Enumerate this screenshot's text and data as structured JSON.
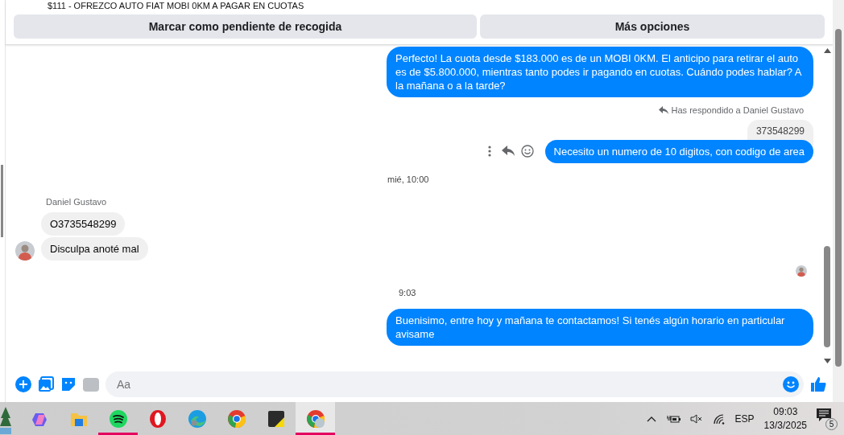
{
  "header": {
    "listing_title": "$111 - OFREZCO AUTO FIAT MOBI 0KM A PAGAR EN CUOTAS",
    "buttons": [
      "Marcar como pendiente de recogida",
      "Más opciones"
    ]
  },
  "messages": [
    {
      "kind": "outgoing",
      "text": "Perfecto! La cuota desde $183.000 es de un MOBI 0KM. El anticipo para retirar el auto es de $5.800.000, mientras tanto podes ir pagando en cuotas. Cuándo podes hablar? A la mañana o a la tarde?"
    },
    {
      "kind": "reply_note",
      "text": "Has respondido a Daniel Gustavo"
    },
    {
      "kind": "quoted",
      "text": "373548299"
    },
    {
      "kind": "outgoing_actions",
      "text": "Necesito un numero de 10 digitos, con codigo de area"
    },
    {
      "kind": "time",
      "text": "mié, 10:00"
    },
    {
      "kind": "sender",
      "text": "Daniel Gustavo"
    },
    {
      "kind": "incoming",
      "text": "O3735548299",
      "avatar": false
    },
    {
      "kind": "incoming",
      "text": "Disculpa anoté mal",
      "avatar": true
    },
    {
      "kind": "seen"
    },
    {
      "kind": "time",
      "text": "9:03"
    },
    {
      "kind": "outgoing",
      "text": "Buenisimo, entre hoy y mañana te contactamos! Si tenés algún horario en particular avisame"
    }
  ],
  "composer": {
    "placeholder": "Aa"
  },
  "taskbar": {
    "apps": [
      {
        "kind": "copilot",
        "running": false
      },
      {
        "kind": "folder",
        "running": false
      },
      {
        "kind": "spotify",
        "running": true
      },
      {
        "kind": "opera",
        "running": false
      },
      {
        "kind": "edge",
        "running": false
      },
      {
        "kind": "chrome",
        "running": false
      },
      {
        "kind": "sticky",
        "running": false
      },
      {
        "kind": "chrome_profile",
        "running": true
      }
    ],
    "language": "ESP",
    "time": "09:03",
    "date": "13/3/2025",
    "notifications": "5"
  }
}
